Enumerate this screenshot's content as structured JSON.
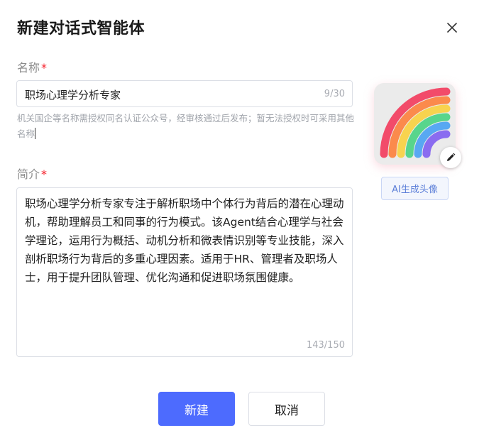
{
  "dialog": {
    "title": "新建对话式智能体"
  },
  "name_field": {
    "label": "名称",
    "required_mark": "*",
    "value": "职场心理学分析专家",
    "counter": "9/30",
    "hint": "机关国企等名称需授权同名认证公众号，经审核通过后发布；暂无法授权时可采用其他名称"
  },
  "intro_field": {
    "label": "简介",
    "required_mark": "*",
    "value": "职场心理学分析专家专注于解析职场中个体行为背后的潜在心理动机，帮助理解员工和同事的行为模式。该Agent结合心理学与社会学理论，运用行为概括、动机分析和微表情识别等专业技能，深入剖析职场行为背后的多重心理因素。适用于HR、管理者及职场人士，用于提升团队管理、优化沟通和促进职场氛围健康。",
    "counter": "143/150"
  },
  "avatar": {
    "icon": "rainbow-icon",
    "edit_icon": "pencil-icon",
    "ai_button_label": "AI生成头像"
  },
  "footer": {
    "create_label": "新建",
    "cancel_label": "取消"
  },
  "colors": {
    "primary": "#4d6bfe",
    "required": "#f5222d",
    "ai_button_text": "#5b7ed8"
  }
}
